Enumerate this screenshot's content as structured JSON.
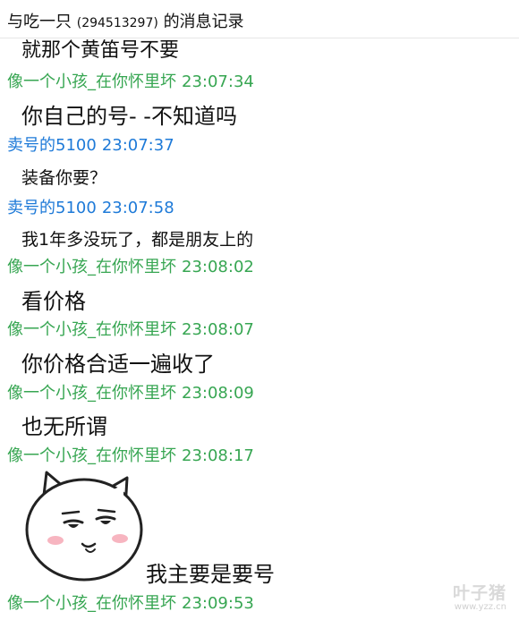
{
  "window": {
    "title_prefix": "与吃一只",
    "title_qq": "(294513297)",
    "title_suffix": "的消息记录"
  },
  "messages": [
    {
      "text": "就那个黄笛号不要",
      "sender": "",
      "time": "",
      "partial": true
    },
    {
      "sender": "像一个小孩_在你怀里坏",
      "time": "23:07:34"
    },
    {
      "text": "你自己的号- -不知道吗",
      "sender": "卖号的5100",
      "time": "23:07:37"
    },
    {
      "text": "装备你要？",
      "sender": "卖号的5100",
      "time": "23:07:58"
    },
    {
      "text": "我1年多没玩了，都是朋友上的",
      "sender": "像一个小孩_在你怀里坏",
      "time": "23:08:02"
    },
    {
      "text": "看价格",
      "sender": "像一个小孩_在你怀里坏",
      "time": "23:08:07"
    },
    {
      "text": "你价格合适一遍收了",
      "sender": "像一个小孩_在你怀里坏",
      "time": "23:08:09"
    },
    {
      "text": "也无所谓",
      "sender": "像一个小孩_在你怀里坏",
      "time": "23:08:17"
    },
    {
      "text": "我主要是要号",
      "sender": "像一个小孩_在你怀里坏",
      "time": "23:09:53",
      "has_sticker": true
    }
  ],
  "colors": {
    "self_sender": "#37a652",
    "other_sender": "#1e7ad8"
  },
  "icons": {
    "sticker": "smug-cat-face-sticker"
  },
  "watermark": {
    "brand": "叶子猪",
    "url": "www.yzz.cn"
  }
}
